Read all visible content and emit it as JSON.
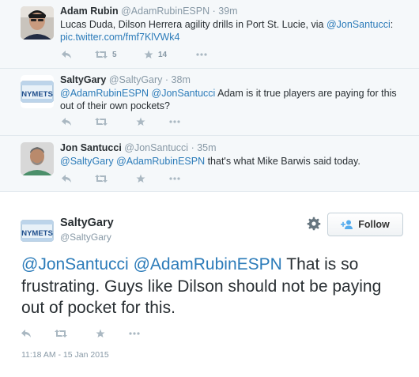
{
  "thread": [
    {
      "name": "Adam Rubin",
      "handle": "@AdamRubinESPN",
      "time": "· 39m",
      "text_parts": [
        {
          "t": "Lucas Duda, Dilson Herrera agility drills in Port St. Lucie, via ",
          "c": ""
        },
        {
          "t": "@JonSantucci",
          "c": "mention"
        },
        {
          "t": ":",
          "c": ""
        },
        {
          "t": "pic.twitter.com/fmf7KlVWk4",
          "c": "link"
        }
      ],
      "retweets": "5",
      "favorites": "14"
    },
    {
      "name": "SaltyGary",
      "handle": "@SaltyGary",
      "time": "· 38m",
      "text_parts": [
        {
          "t": "@AdamRubinESPN",
          "c": "mention"
        },
        {
          "t": " ",
          "c": ""
        },
        {
          "t": "@JonSantucci",
          "c": "mention"
        },
        {
          "t": " Adam is it true players are paying for this out of their own pockets?",
          "c": ""
        }
      ],
      "retweets": "",
      "favorites": ""
    },
    {
      "name": "Jon Santucci",
      "handle": "@JonSantucci",
      "time": "· 35m",
      "text_parts": [
        {
          "t": "@SaltyGary",
          "c": "mention"
        },
        {
          "t": " ",
          "c": ""
        },
        {
          "t": "@AdamRubinESPN",
          "c": "mention"
        },
        {
          "t": " that's what Mike Barwis said today.",
          "c": ""
        }
      ],
      "retweets": "",
      "favorites": ""
    }
  ],
  "main": {
    "name": "SaltyGary",
    "handle": "@SaltyGary",
    "follow_label": "Follow",
    "text_parts": [
      {
        "t": "@JonSantucci",
        "c": "mention"
      },
      {
        "t": " ",
        "c": ""
      },
      {
        "t": "@AdamRubinESPN",
        "c": "mention"
      },
      {
        "t": " That is so frustrating. Guys like Dilson should not be paying out of pocket for this.",
        "c": ""
      }
    ],
    "timestamp": "11:18 AM - 15 Jan 2015"
  },
  "avatar_texts": {
    "nymets_plate": "NYMETS"
  },
  "icons": {
    "reply": "reply-icon",
    "retweet": "retweet-icon",
    "favorite": "star-icon",
    "more": "more-icon",
    "settings": "gear-icon",
    "follow": "follow-person-icon"
  },
  "colors": {
    "link": "#2b7bb9",
    "muted": "#8899a6",
    "icon": "#aab8c2",
    "text": "#292f33",
    "thread_bg": "#f5f8fa",
    "main_bg": "#ffffff"
  }
}
